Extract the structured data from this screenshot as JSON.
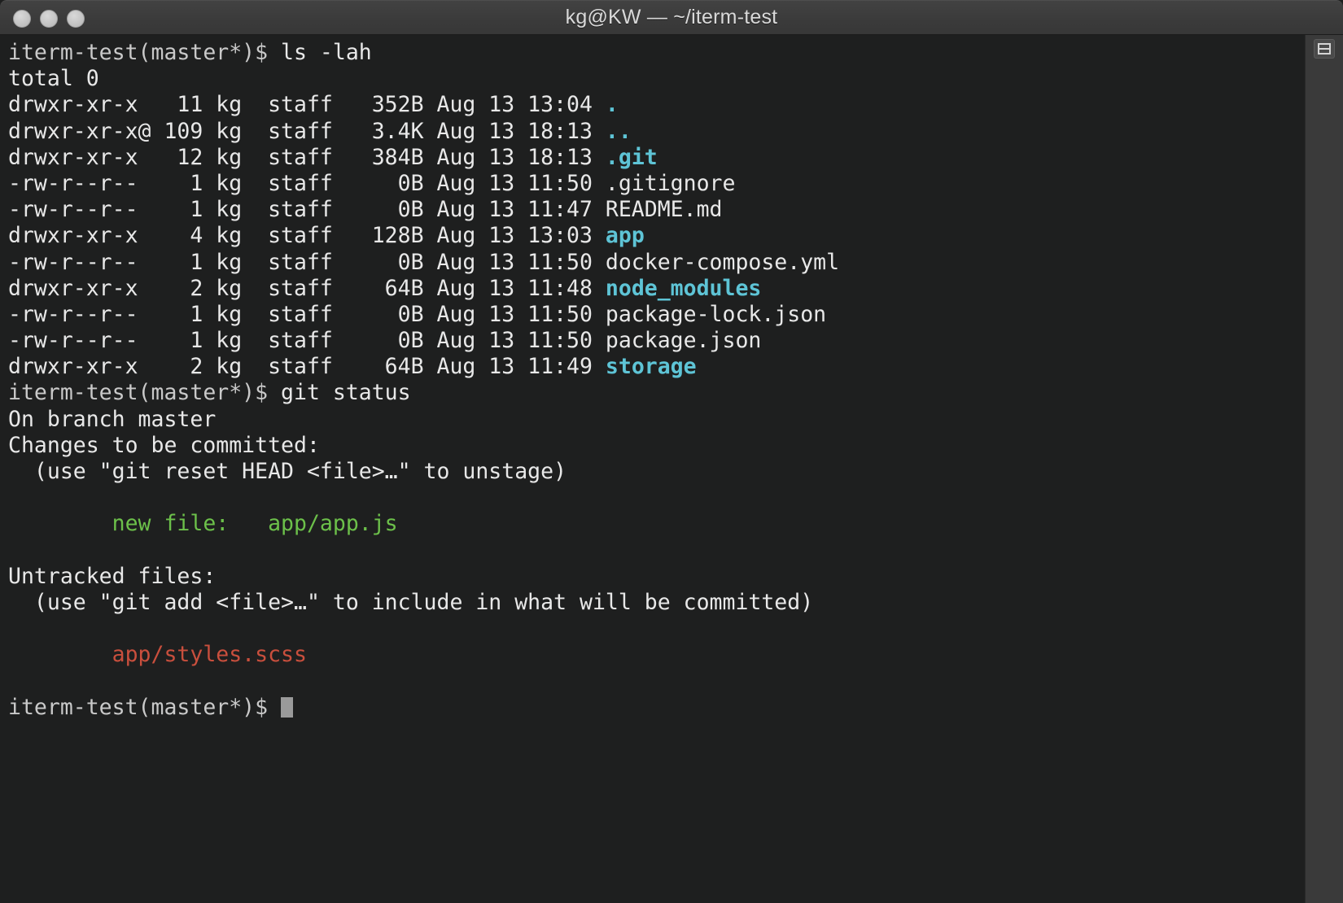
{
  "window": {
    "title": "kg@KW — ~/iterm-test",
    "traffic_lights": [
      "close",
      "minimize",
      "zoom"
    ]
  },
  "terminal": {
    "prompt": "iterm-test(master*)$ ",
    "lines": [
      {
        "segments": [
          {
            "text": "iterm-test(master*)$ ",
            "style": "prompt"
          },
          {
            "text": "ls -lah",
            "style": "default"
          }
        ]
      },
      {
        "segments": [
          {
            "text": "total 0",
            "style": "default"
          }
        ]
      },
      {
        "segments": [
          {
            "text": "drwxr-xr-x   11 kg  staff   352B Aug 13 13:04 ",
            "style": "default"
          },
          {
            "text": ".",
            "style": "dir"
          }
        ]
      },
      {
        "segments": [
          {
            "text": "drwxr-xr-x@ 109 kg  staff   3.4K Aug 13 18:13 ",
            "style": "default"
          },
          {
            "text": "..",
            "style": "dir"
          }
        ]
      },
      {
        "segments": [
          {
            "text": "drwxr-xr-x   12 kg  staff   384B Aug 13 18:13 ",
            "style": "default"
          },
          {
            "text": ".git",
            "style": "dir"
          }
        ]
      },
      {
        "segments": [
          {
            "text": "-rw-r--r--    1 kg  staff     0B Aug 13 11:50 .gitignore",
            "style": "default"
          }
        ]
      },
      {
        "segments": [
          {
            "text": "-rw-r--r--    1 kg  staff     0B Aug 13 11:47 README.md",
            "style": "default"
          }
        ]
      },
      {
        "segments": [
          {
            "text": "drwxr-xr-x    4 kg  staff   128B Aug 13 13:03 ",
            "style": "default"
          },
          {
            "text": "app",
            "style": "dir"
          }
        ]
      },
      {
        "segments": [
          {
            "text": "-rw-r--r--    1 kg  staff     0B Aug 13 11:50 docker-compose.yml",
            "style": "default"
          }
        ]
      },
      {
        "segments": [
          {
            "text": "drwxr-xr-x    2 kg  staff    64B Aug 13 11:48 ",
            "style": "default"
          },
          {
            "text": "node_modules",
            "style": "dir"
          }
        ]
      },
      {
        "segments": [
          {
            "text": "-rw-r--r--    1 kg  staff     0B Aug 13 11:50 package-lock.json",
            "style": "default"
          }
        ]
      },
      {
        "segments": [
          {
            "text": "-rw-r--r--    1 kg  staff     0B Aug 13 11:50 package.json",
            "style": "default"
          }
        ]
      },
      {
        "segments": [
          {
            "text": "drwxr-xr-x    2 kg  staff    64B Aug 13 11:49 ",
            "style": "default"
          },
          {
            "text": "storage",
            "style": "dir"
          }
        ]
      },
      {
        "segments": [
          {
            "text": "iterm-test(master*)$ ",
            "style": "prompt"
          },
          {
            "text": "git status",
            "style": "default"
          }
        ]
      },
      {
        "segments": [
          {
            "text": "On branch master",
            "style": "default"
          }
        ]
      },
      {
        "segments": [
          {
            "text": "Changes to be committed:",
            "style": "default"
          }
        ]
      },
      {
        "segments": [
          {
            "text": "  (use \"git reset HEAD <file>…\" to unstage)",
            "style": "default"
          }
        ]
      },
      {
        "segments": [
          {
            "text": "",
            "style": "default"
          }
        ]
      },
      {
        "segments": [
          {
            "text": "        new file:   app/app.js",
            "style": "green"
          }
        ]
      },
      {
        "segments": [
          {
            "text": "",
            "style": "default"
          }
        ]
      },
      {
        "segments": [
          {
            "text": "Untracked files:",
            "style": "default"
          }
        ]
      },
      {
        "segments": [
          {
            "text": "  (use \"git add <file>…\" to include in what will be committed)",
            "style": "default"
          }
        ]
      },
      {
        "segments": [
          {
            "text": "",
            "style": "default"
          }
        ]
      },
      {
        "segments": [
          {
            "text": "        app/styles.scss",
            "style": "red"
          }
        ]
      },
      {
        "segments": [
          {
            "text": "",
            "style": "default"
          }
        ]
      },
      {
        "segments": [
          {
            "text": "iterm-test(master*)$ ",
            "style": "prompt"
          },
          {
            "text": "",
            "style": "cursor"
          }
        ]
      }
    ]
  },
  "colors": {
    "background": "#1e1f1f",
    "titlebar": "#3d3d3d",
    "foreground": "#e8e8e8",
    "prompt": "#c9c9c9",
    "directory": "#5ec4d6",
    "staged": "#6cc04a",
    "untracked": "#c94f3d",
    "cursor": "#9a9a9a",
    "scroll_gutter": "#3a3a3a"
  }
}
